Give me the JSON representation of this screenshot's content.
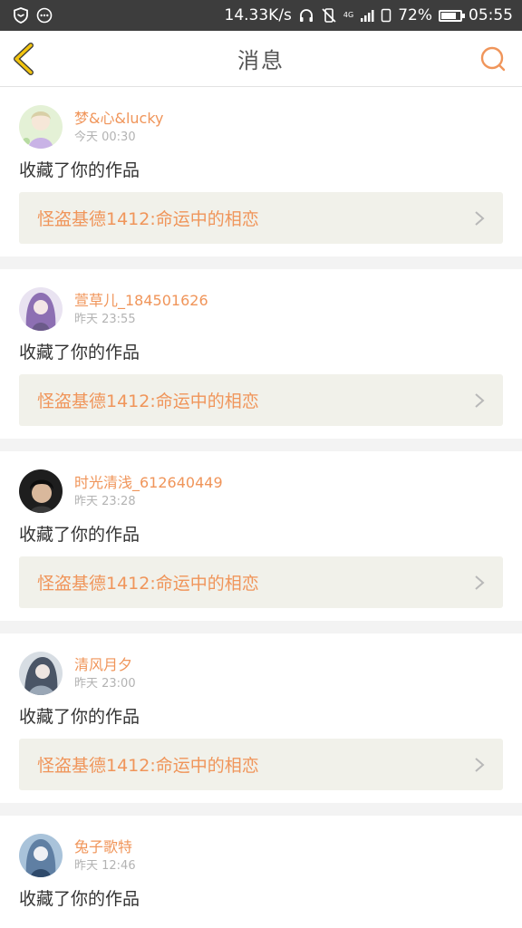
{
  "statusbar": {
    "speed": "14.33K/s",
    "network": "4G",
    "battery": "72%",
    "time": "05:55"
  },
  "header": {
    "title": "消息",
    "back_icon": "chevron-left-icon",
    "search_icon": "search-icon"
  },
  "colors": {
    "accent": "#f0955a",
    "back": "#f2c40f",
    "statusbar": "#3d3d3d",
    "card_bg": "#f1f1ea",
    "separator": "#f3f3f3"
  },
  "messages": [
    {
      "username": "梦&心&lucky",
      "time": "今天  00:30",
      "action": "收藏了你的作品",
      "work": "怪盗基德1412:命运中的相恋"
    },
    {
      "username": "萱草儿_184501626",
      "time": "昨天  23:55",
      "action": "收藏了你的作品",
      "work": "怪盗基德1412:命运中的相恋"
    },
    {
      "username": "时光清浅_612640449",
      "time": "昨天  23:28",
      "action": "收藏了你的作品",
      "work": "怪盗基德1412:命运中的相恋"
    },
    {
      "username": "清风月夕",
      "time": "昨天  23:00",
      "action": "收藏了你的作品",
      "work": "怪盗基德1412:命运中的相恋"
    },
    {
      "username": "兔子歌特",
      "time": "昨天  12:46",
      "action": "收藏了你的作品",
      "work": ""
    }
  ]
}
